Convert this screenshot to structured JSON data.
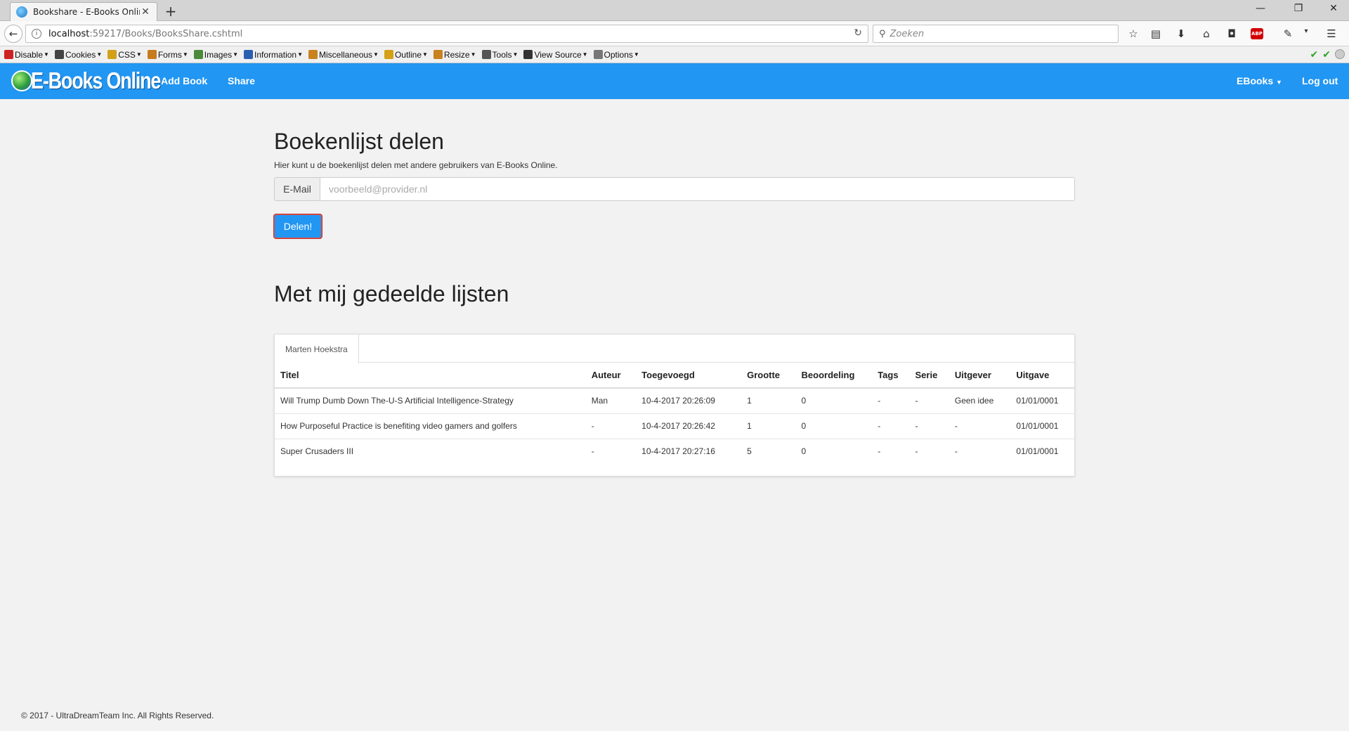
{
  "browser": {
    "tab_title": "Bookshare - E-Books Online",
    "url_host": "localhost",
    "url_path": ":59217/Books/BooksShare.cshtml",
    "search_placeholder": "Zoeken"
  },
  "devtoolbar": {
    "items": [
      "Disable",
      "Cookies",
      "CSS",
      "Forms",
      "Images",
      "Information",
      "Miscellaneous",
      "Outline",
      "Resize",
      "Tools",
      "View Source",
      "Options"
    ],
    "icon_colors": [
      "#cc2222",
      "#444444",
      "#d4a017",
      "#c87a1e",
      "#4a8a3a",
      "#2a5fb0",
      "#c8821e",
      "#d4a017",
      "#c8821e",
      "#555555",
      "#333333",
      "#777777"
    ],
    "icon_names": [
      "disable-icon",
      "cookies-icon",
      "css-icon",
      "forms-icon",
      "images-icon",
      "information-icon",
      "miscellaneous-icon",
      "outline-icon",
      "resize-icon",
      "tools-icon",
      "view-source-icon",
      "options-icon"
    ]
  },
  "app": {
    "brand": "E-Books Online",
    "nav_add": "Add Book",
    "nav_share": "Share",
    "nav_ebooks": "EBooks",
    "nav_logout": "Log out",
    "accent": "#2196f3"
  },
  "share": {
    "title": "Boekenlijst delen",
    "description": "Hier kunt u de boekenlijst delen met andere gebruikers van E-Books Online.",
    "email_label": "E-Mail",
    "email_placeholder": "voorbeeld@provider.nl",
    "button": "Delen!"
  },
  "shared": {
    "title": "Met mij gedeelde lijsten",
    "tab": "Marten Hoekstra",
    "columns": [
      "Titel",
      "Auteur",
      "Toegevoegd",
      "Grootte",
      "Beoordeling",
      "Tags",
      "Serie",
      "Uitgever",
      "Uitgave"
    ],
    "rows": [
      [
        "Will Trump Dumb Down The-U-S Artificial Intelligence-Strategy",
        "Man",
        "10-4-2017 20:26:09",
        "1",
        "0",
        "-",
        "-",
        "Geen idee",
        "01/01/0001"
      ],
      [
        "How Purposeful Practice is benefiting video gamers and golfers",
        "-",
        "10-4-2017 20:26:42",
        "1",
        "0",
        "-",
        "-",
        "-",
        "01/01/0001"
      ],
      [
        "Super Crusaders III",
        "-",
        "10-4-2017 20:27:16",
        "5",
        "0",
        "-",
        "-",
        "-",
        "01/01/0001"
      ]
    ]
  },
  "footer": "© 2017 - UltraDreamTeam Inc. All Rights Reserved."
}
